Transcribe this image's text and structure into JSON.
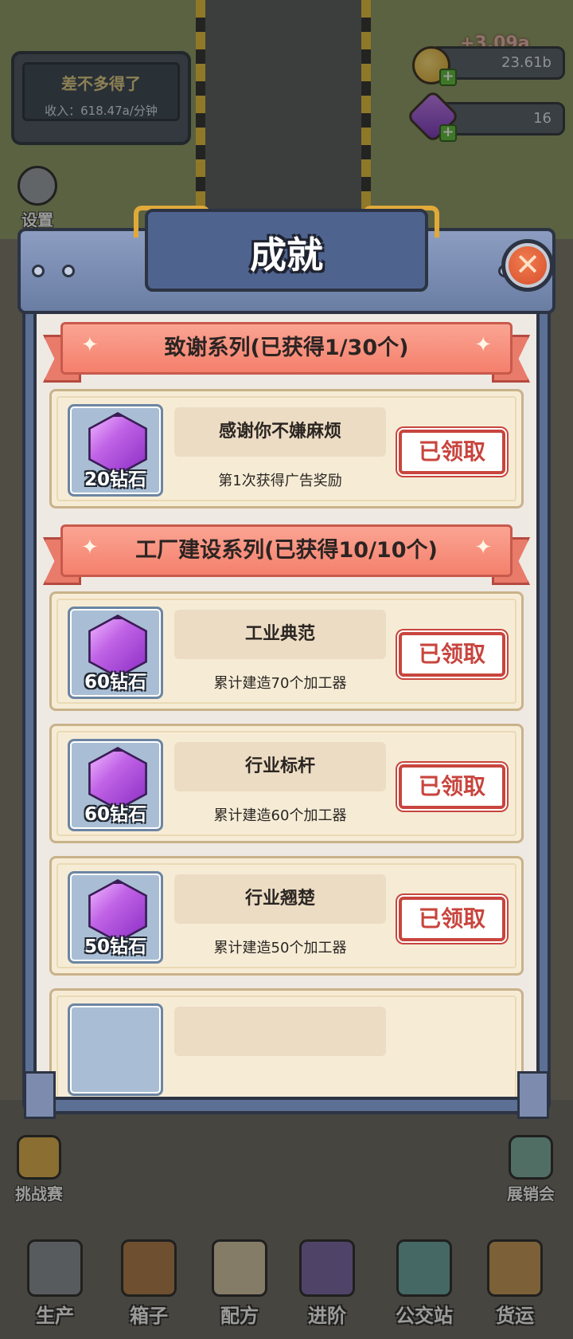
{
  "hud": {
    "status_title": "差不多得了",
    "income": "收入：618.47a/分钟",
    "coin_gain": "+3.09a",
    "coins": "23.61b",
    "gems": "16",
    "settings_label": "设置"
  },
  "modal": {
    "title": "成就",
    "close_symbol": "✕",
    "sections": [
      {
        "title": "致谢系列(已获得1/30个)",
        "items": [
          {
            "reward": "20钻石",
            "name": "感谢你不嫌麻烦",
            "desc": "第1次获得广告奖励",
            "button": "已领取"
          }
        ]
      },
      {
        "title": "工厂建设系列(已获得10/10个)",
        "items": [
          {
            "reward": "60钻石",
            "name": "工业典范",
            "desc": "累计建造70个加工器",
            "button": "已领取"
          },
          {
            "reward": "60钻石",
            "name": "行业标杆",
            "desc": "累计建造60个加工器",
            "button": "已领取"
          },
          {
            "reward": "50钻石",
            "name": "行业翘楚",
            "desc": "累计建造50个加工器",
            "button": "已领取"
          }
        ]
      }
    ]
  },
  "side_buttons": {
    "challenge": "挑战赛",
    "expo": "展销会"
  },
  "bottom_nav": [
    "生产",
    "箱子",
    "配方",
    "进阶",
    "公交站",
    "货运"
  ],
  "colors": {
    "banner": "#f4806c",
    "claimed_red": "#c8453e",
    "gem_purple": "#c063e6",
    "frame_blue": "#5c6f94"
  }
}
